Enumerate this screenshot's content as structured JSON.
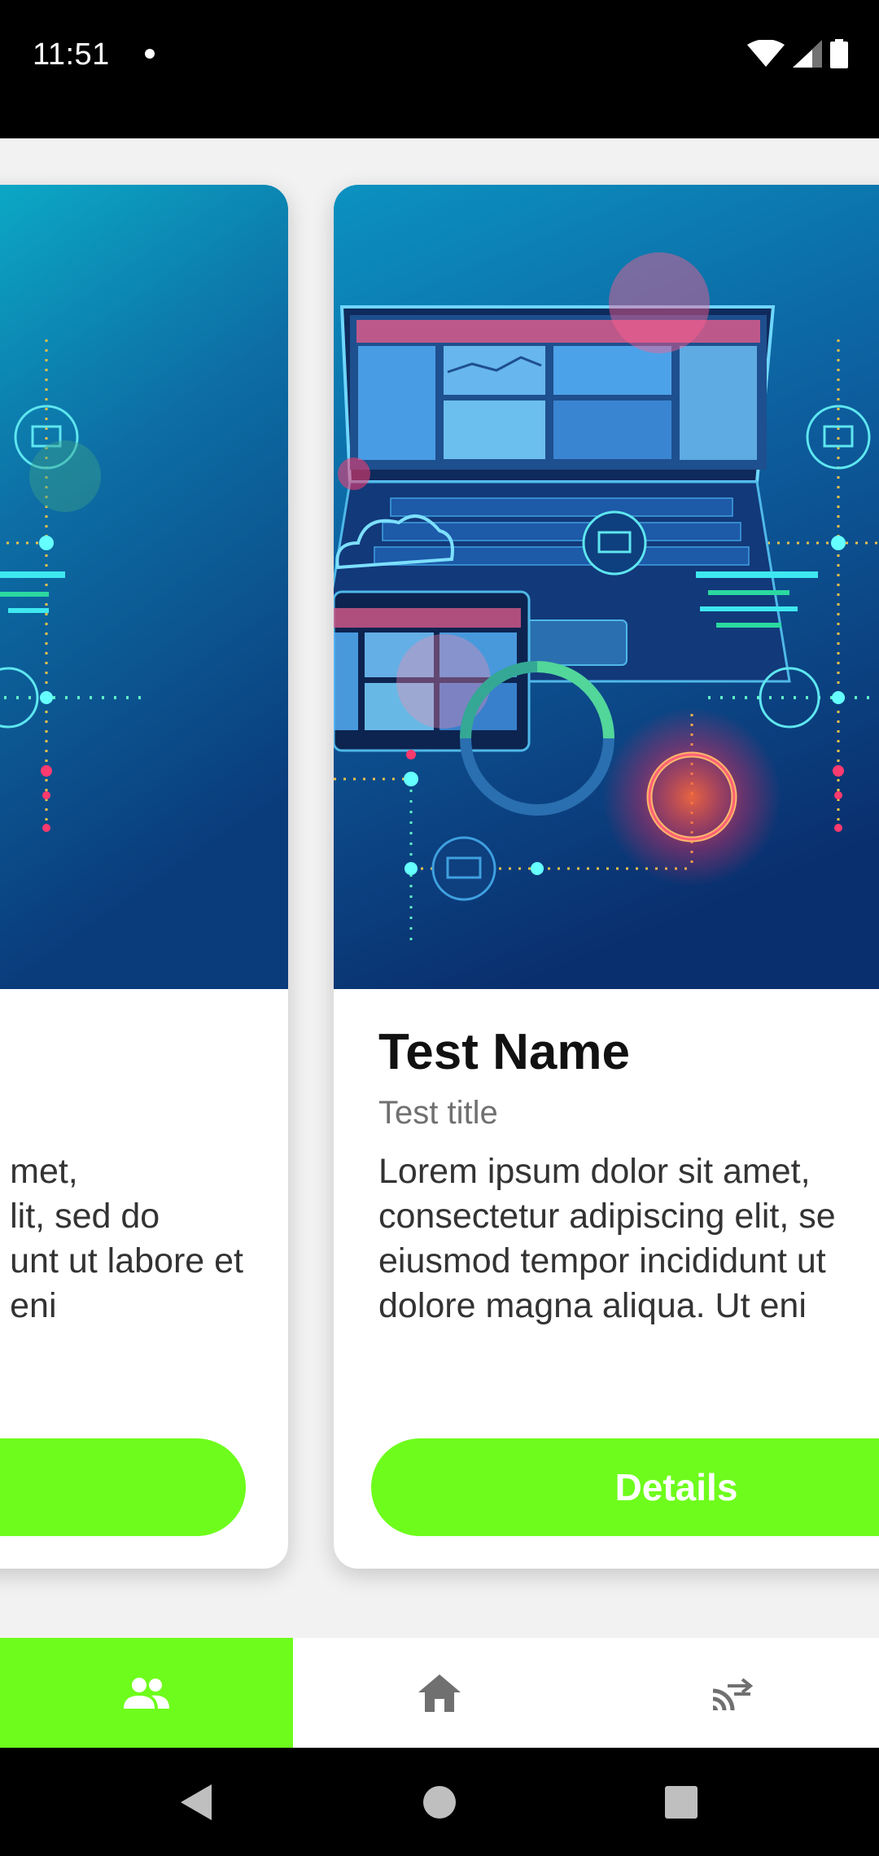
{
  "status_bar": {
    "time": "11:51",
    "icons": [
      "notification-dot-icon",
      "wifi-icon",
      "signal-icon",
      "battery-icon"
    ]
  },
  "cards": [
    {
      "position": "previous",
      "body_fragments": [
        "met,",
        "lit, sed do",
        "unt ut labore et",
        "eni"
      ]
    },
    {
      "position": "current",
      "name": "Test Name",
      "title": "Test title",
      "body_lines": [
        "Lorem ipsum dolor sit amet,",
        "consectetur adipiscing elit, se",
        "eiusmod tempor incididunt ut",
        "dolore magna aliqua. Ut eni"
      ],
      "button_label": "Details"
    }
  ],
  "bottom_nav": {
    "items": [
      {
        "icon": "people-icon",
        "active": true
      },
      {
        "icon": "home-icon",
        "active": false
      },
      {
        "icon": "cast-icon",
        "active": false
      }
    ]
  },
  "colors": {
    "accent": "#6efc1c",
    "card_bg": "#ffffff",
    "page_bg": "#f2f2f2",
    "nav_icon_active": "#ffffff",
    "nav_icon_inactive": "#707070"
  },
  "system_nav": [
    "back-icon",
    "home-circle-icon",
    "recents-icon"
  ]
}
